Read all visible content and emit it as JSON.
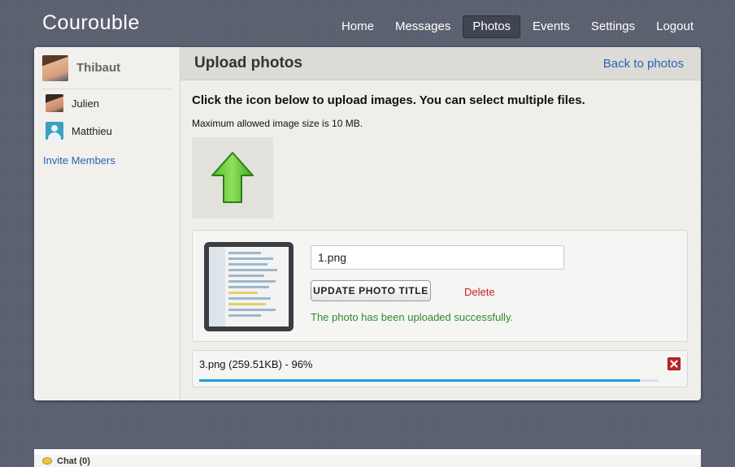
{
  "app": {
    "brand": "Courouble"
  },
  "nav": {
    "items": [
      {
        "label": "Home",
        "active": false
      },
      {
        "label": "Messages",
        "active": false
      },
      {
        "label": "Photos",
        "active": true
      },
      {
        "label": "Events",
        "active": false
      },
      {
        "label": "Settings",
        "active": false
      },
      {
        "label": "Logout",
        "active": false
      }
    ]
  },
  "sidebar": {
    "user": {
      "name": "Thibaut"
    },
    "members": [
      {
        "name": "Julien",
        "avatar": "photo"
      },
      {
        "name": "Matthieu",
        "avatar": "default-user-icon"
      }
    ],
    "invite_label": "Invite Members"
  },
  "main": {
    "title": "Upload photos",
    "back_link": "Back to photos",
    "instructions": "Click the icon below to upload images. You can select multiple files.",
    "max_size_note": "Maximum allowed image size is 10 MB.",
    "upload_icon": "green-up-arrow-icon"
  },
  "photo": {
    "title_value": "1.png",
    "update_button": "UPDATE PHOTO TITLE",
    "delete_label": "Delete",
    "success_message": "The photo has been uploaded successfully."
  },
  "upload_progress": {
    "label": "3.png (259.51KB) - 96%",
    "percent": 96
  },
  "chat": {
    "label": "Chat (0)"
  },
  "colors": {
    "link": "#2a62b8",
    "delete": "#c62020",
    "success": "#2f8a2f",
    "progress": "#1f9ae0",
    "cancel": "#c3232b"
  }
}
